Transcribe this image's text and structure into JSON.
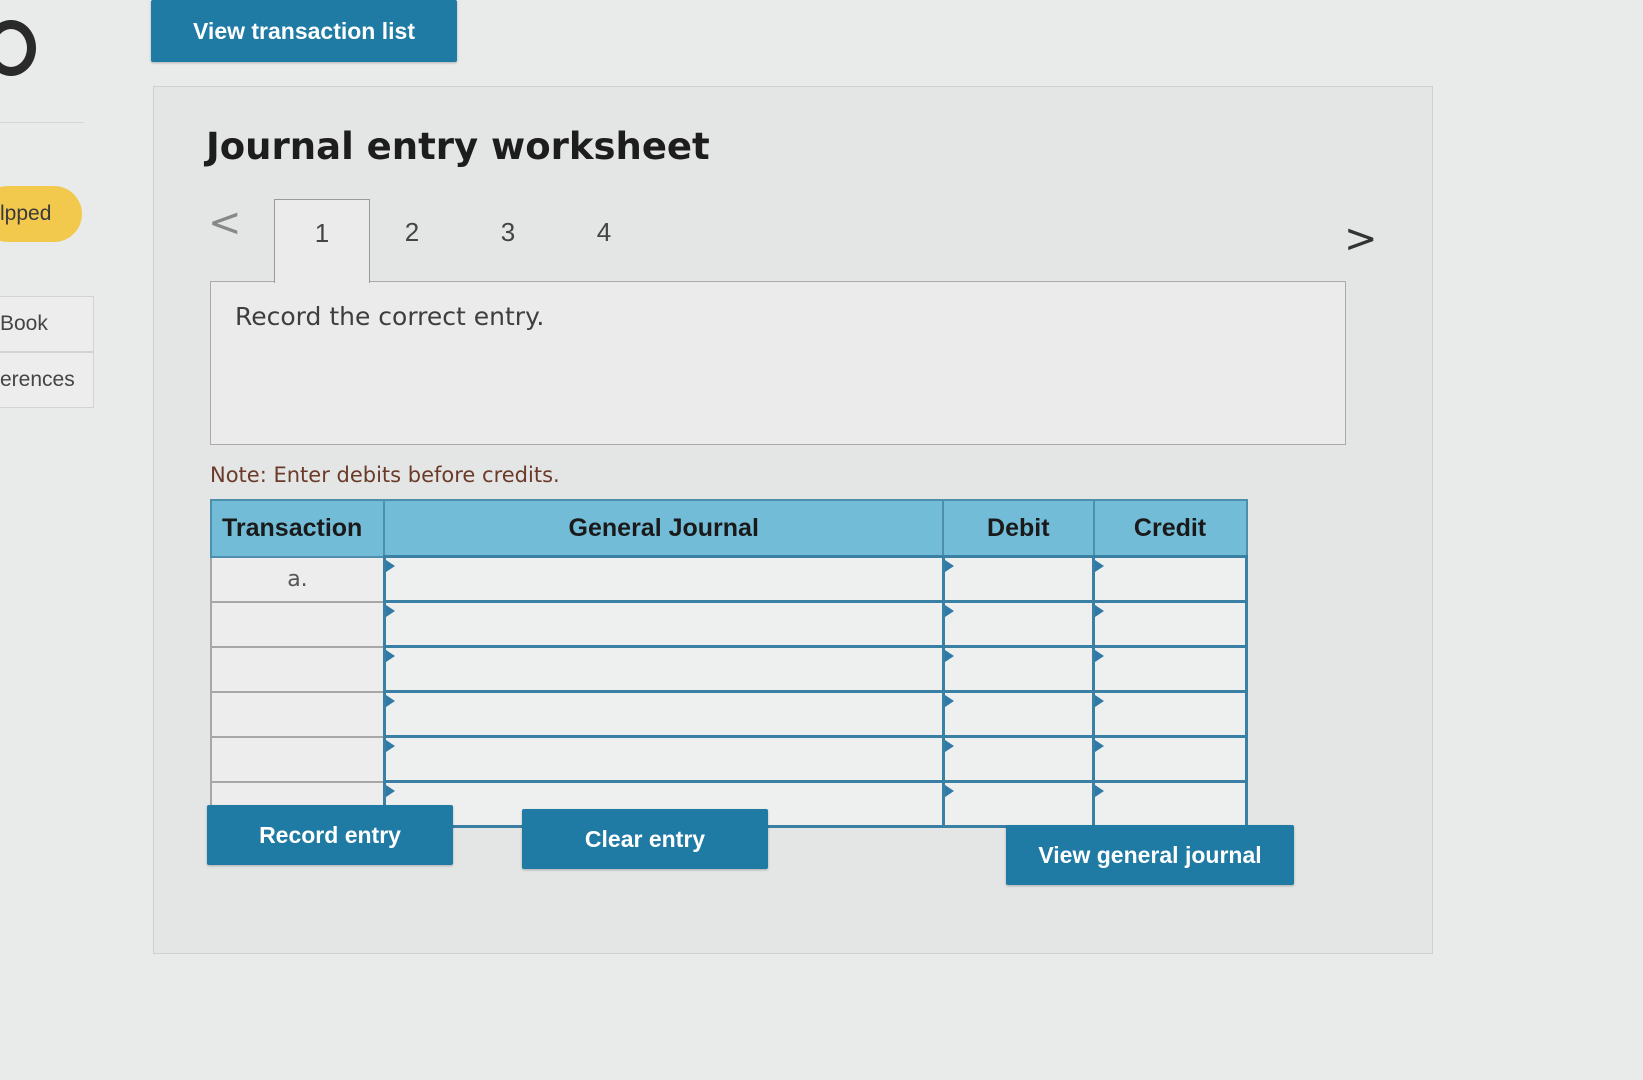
{
  "left_panel": {
    "status_label": "lpped",
    "links": [
      {
        "label": "Book"
      },
      {
        "label": "erences"
      }
    ]
  },
  "header": {
    "view_transaction_list_label": "View transaction list"
  },
  "worksheet": {
    "title": "Journal entry worksheet",
    "nav": {
      "prev": "<",
      "next": ">"
    },
    "tabs": [
      {
        "label": "1",
        "active": true
      },
      {
        "label": "2",
        "active": false
      },
      {
        "label": "3",
        "active": false
      },
      {
        "label": "4",
        "active": false
      }
    ],
    "instruction": "Record the correct entry.",
    "note": "Note: Enter debits before credits.",
    "table": {
      "headers": [
        "Transaction",
        "General Journal",
        "Debit",
        "Credit"
      ],
      "rows": [
        {
          "transaction": "a.",
          "account": "",
          "debit": "",
          "credit": ""
        },
        {
          "transaction": "",
          "account": "",
          "debit": "",
          "credit": ""
        },
        {
          "transaction": "",
          "account": "",
          "debit": "",
          "credit": ""
        },
        {
          "transaction": "",
          "account": "",
          "debit": "",
          "credit": ""
        },
        {
          "transaction": "",
          "account": "",
          "debit": "",
          "credit": ""
        },
        {
          "transaction": "",
          "account": "",
          "debit": "",
          "credit": ""
        }
      ]
    },
    "buttons": {
      "record_entry": "Record entry",
      "clear_entry": "Clear entry",
      "view_general_journal": "View general journal"
    }
  },
  "colors": {
    "accent": "#1f7aa4",
    "table_header": "#72bcd8",
    "status_pill": "#f2c94c"
  }
}
